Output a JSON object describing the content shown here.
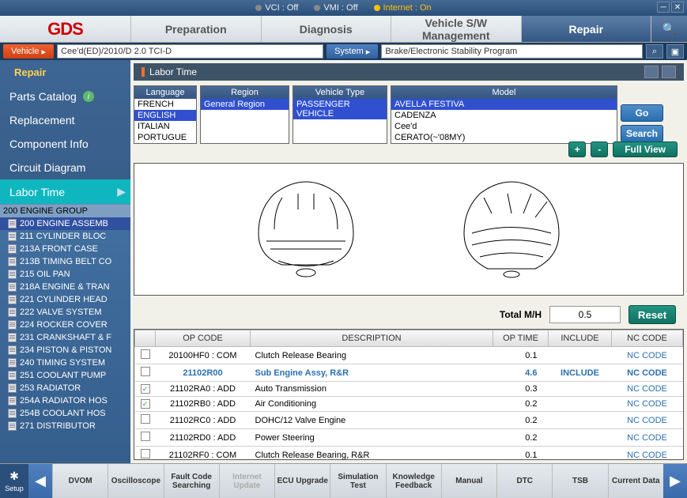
{
  "topbar": {
    "vci": "VCI : Off",
    "vmi": "VMI : Off",
    "internet": "Internet : On"
  },
  "nav": {
    "logo": "GDS",
    "tabs": [
      "Preparation",
      "Diagnosis",
      "Vehicle S/W Management",
      "Repair"
    ],
    "search_icon": "🔍"
  },
  "selbar": {
    "vehicle_label": "Vehicle",
    "vehicle_value": "Cee'd(ED)/2010/D 2.0 TCI-D",
    "system_label": "System",
    "system_value": "Brake/Electronic Stability Program"
  },
  "sidebar": {
    "title": "Repair",
    "items": [
      "Parts Catalog",
      "Replacement",
      "Component Info",
      "Circuit Diagram",
      "Labor Time"
    ],
    "tree": [
      {
        "t": "200 ENGINE GROUP",
        "g": true
      },
      {
        "t": "200 ENGINE ASSEMB",
        "sel": true
      },
      {
        "t": "211 CYLINDER BLOC"
      },
      {
        "t": "213A FRONT CASE"
      },
      {
        "t": "213B TIMING BELT CO"
      },
      {
        "t": "215 OIL PAN"
      },
      {
        "t": "218A ENGINE & TRAN"
      },
      {
        "t": "221 CYLINDER HEAD"
      },
      {
        "t": "222 VALVE SYSTEM"
      },
      {
        "t": "224 ROCKER COVER"
      },
      {
        "t": "231 CRANKSHAFT & F"
      },
      {
        "t": "234 PISTON & PISTON"
      },
      {
        "t": "240 TIMING SYSTEM"
      },
      {
        "t": "251 COOLANT PUMP"
      },
      {
        "t": "253 RADIATOR"
      },
      {
        "t": "254A RADIATOR HOS"
      },
      {
        "t": "254B COOLANT HOS"
      },
      {
        "t": "271 DISTRIBUTOR"
      }
    ]
  },
  "content": {
    "title": "Labor Time",
    "filters": {
      "language": {
        "head": "Language",
        "opts": [
          "FRENCH",
          "ENGLISH",
          "ITALIAN",
          "PORTUGUE"
        ],
        "sel": 1
      },
      "region": {
        "head": "Region",
        "opts": [
          "General Region"
        ],
        "sel": 0
      },
      "vtype": {
        "head": "Vehicle Type",
        "opts": [
          "PASSENGER VEHICLE"
        ],
        "sel": 0
      },
      "model": {
        "head": "Model",
        "opts": [
          "AVELLA FESTIVA",
          "CADENZA",
          "Cee'd",
          "CERATO(~'08MY)"
        ],
        "sel": 0
      }
    },
    "btn_go": "Go",
    "btn_search": "Search",
    "btn_plus": "+",
    "btn_minus": "-",
    "btn_full": "Full View",
    "total_label": "Total M/H",
    "total_value": "0.5",
    "btn_reset": "Reset",
    "table": {
      "heads": [
        "",
        "OP CODE",
        "DESCRIPTION",
        "OP TIME",
        "INCLUDE",
        "NC CODE"
      ],
      "rows": [
        {
          "chk": false,
          "op": "20100HF0 : COM",
          "desc": "Clutch Release Bearing",
          "time": "0.1",
          "inc": "",
          "sel": false
        },
        {
          "chk": false,
          "op": "21102R00",
          "desc": "Sub Engine Assy, R&R",
          "time": "4.6",
          "inc": "INCLUDE",
          "sel": true
        },
        {
          "chk": true,
          "op": "21102RA0 : ADD",
          "desc": "Auto Transmission",
          "time": "0.3",
          "inc": "",
          "sel": false
        },
        {
          "chk": true,
          "op": "21102RB0 : ADD",
          "desc": "Air Conditioning",
          "time": "0.2",
          "inc": "",
          "sel": false
        },
        {
          "chk": false,
          "op": "21102RC0 : ADD",
          "desc": "DOHC/12 Valve Engine",
          "time": "0.2",
          "inc": "",
          "sel": false
        },
        {
          "chk": false,
          "op": "21102RD0 : ADD",
          "desc": "Power Steering",
          "time": "0.2",
          "inc": "",
          "sel": false
        },
        {
          "chk": false,
          "op": "21102RF0 : COM",
          "desc": "Clutch Release Bearing, R&R",
          "time": "0.1",
          "inc": "",
          "sel": false
        }
      ],
      "nc": "NC CODE"
    }
  },
  "bottombar": {
    "setup": "Setup",
    "tools": [
      "DVOM",
      "Oscilloscope",
      "Fault Code Searching",
      "Internet Update",
      "ECU Upgrade",
      "Simulation Test",
      "Knowledge Feedback",
      "Manual",
      "DTC",
      "TSB",
      "Current Data"
    ]
  }
}
